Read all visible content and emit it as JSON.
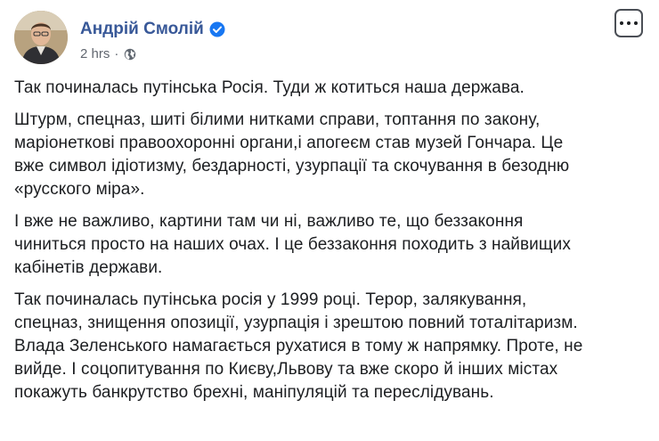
{
  "post": {
    "author": "Андрій Смолій",
    "time": "2 hrs",
    "time_separator": "·",
    "verified_icon": "verified-badge-icon",
    "privacy_icon": "globe-icon",
    "more_icon": "more-options-icon",
    "colors": {
      "name": "#385898",
      "verified": "#1877f2",
      "text": "#1c1e21",
      "meta": "#616770"
    },
    "paragraphs": [
      "Так починалась путінська Росія. Туди ж котиться наша держава.",
      "Штурм, спецназ, шиті білими нитками справи, топтання по закону,\nмаріонеткові правоохоронні органи,і апогеєм став музей Гончара. Це\nвже символ ідіотизму, бездарності, узурпації та скочування в безодню\n«русского міра».",
      "І вже не важливо, картини там чи ні, важливо те, що беззаконня\nчиниться просто на наших очах. І це беззаконня походить з найвищих\nкабінетів держави.",
      "Так починалась путінська росія у 1999 році. Терор, залякування,\nспецназ, знищення опозиції, узурпація і зрештою повний тоталітаризм.\nВлада Зеленського намагається рухатися в тому ж напрямку. Проте, не\nвийде. І соцопитування по Києву,Львову та вже скоро й інших містах\nпокажуть банкрутство брехні, маніпуляцій та переслідувань."
    ]
  }
}
